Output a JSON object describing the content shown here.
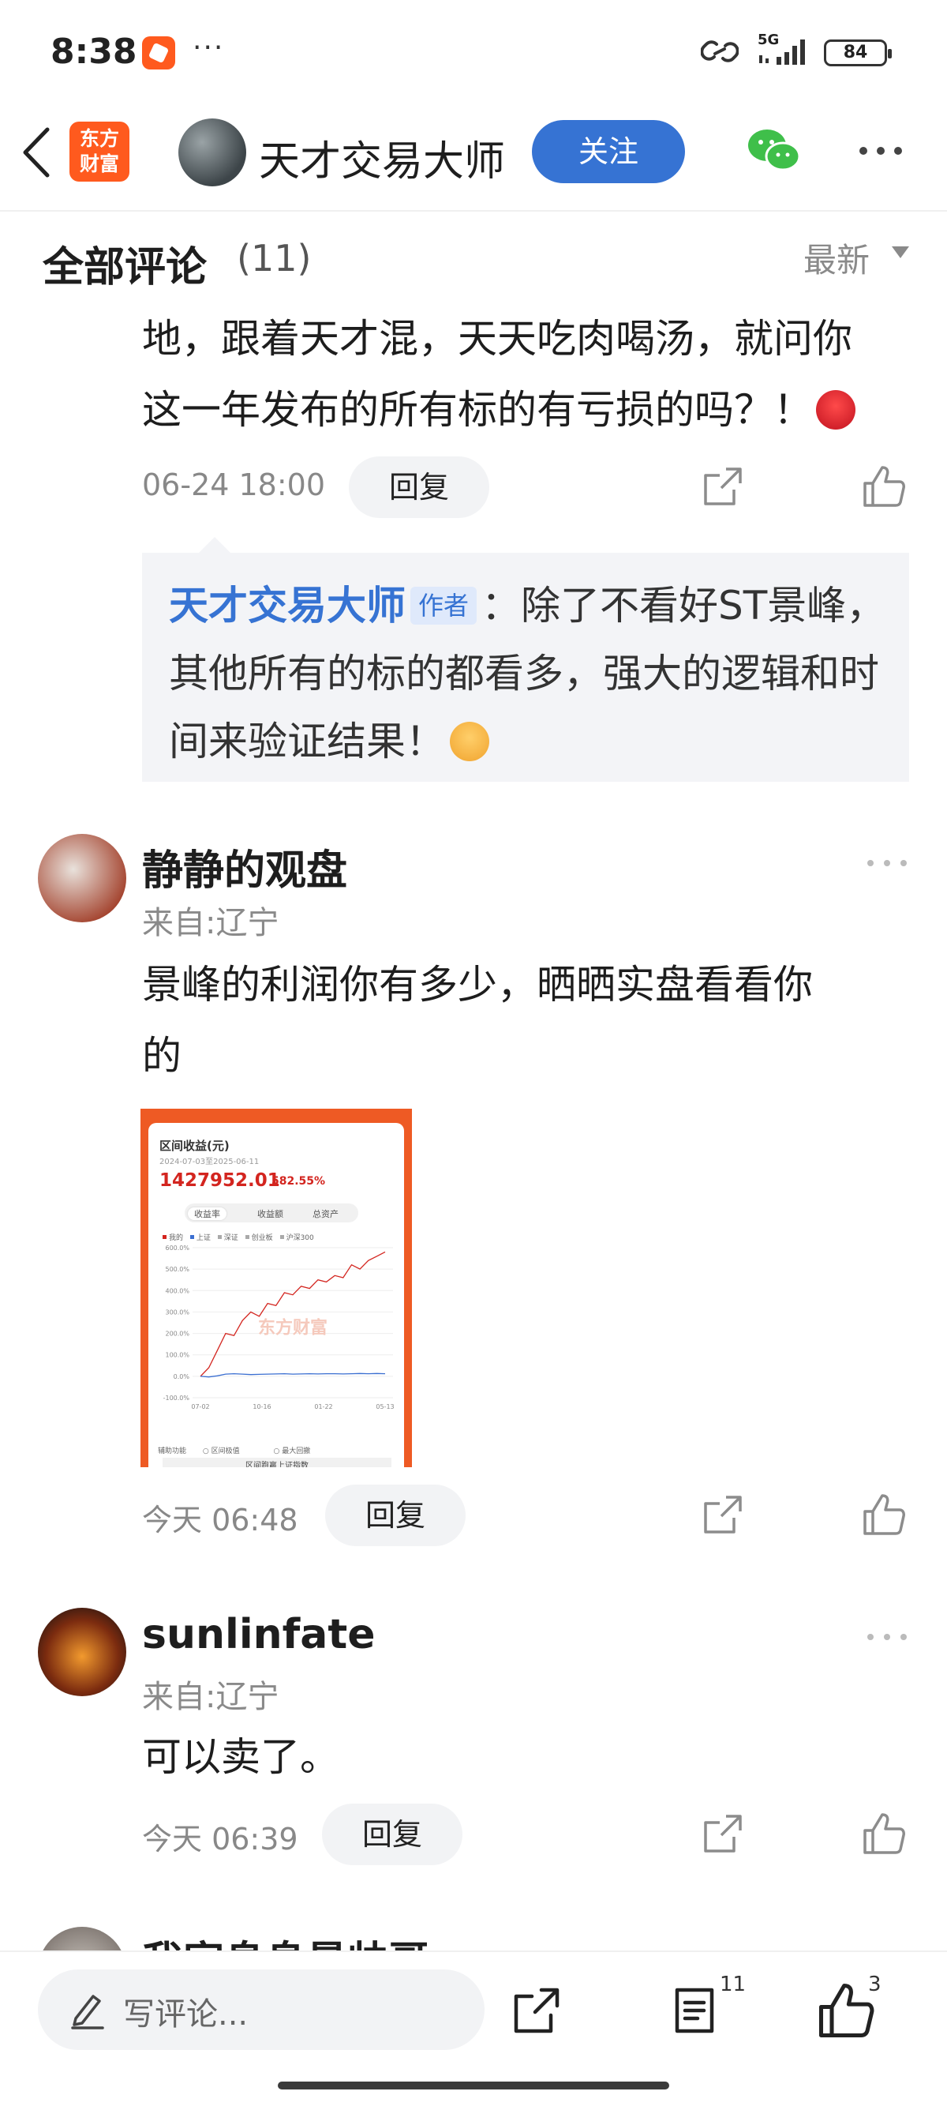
{
  "status_bar": {
    "time": "8:38",
    "dots": "···",
    "network": "5G",
    "battery": "84"
  },
  "header": {
    "brand_line1": "东方",
    "brand_line2": "财富",
    "author_name": "天才交易大师",
    "follow_label": "关注"
  },
  "comments_header": {
    "title": "全部评论",
    "count": "(11)",
    "sort_label": "最新"
  },
  "first_comment": {
    "line1": "地，跟着天才混，天天吃肉喝汤，就问你",
    "line2": "这一年发布的所有标的有亏损的吗？！",
    "time": "06-24 18:00",
    "reply_label": "回复",
    "author_reply": {
      "name": "天才交易大师",
      "tag": "作者",
      "text": "：除了不看好ST景峰，其他所有的标的都看多，强大的逻辑和时间来验证结果！"
    }
  },
  "comments": [
    {
      "username": "静静的观盘",
      "location": "来自:辽宁",
      "text_line1": "景峰的利润你有多少，晒晒实盘看看你",
      "text_line2": "的",
      "time": "今天 06:48",
      "reply_label": "回复"
    },
    {
      "username": "sunlinfate",
      "location": "来自:辽宁",
      "text_line1": "可以卖了。",
      "time": "今天 06:39",
      "reply_label": "回复"
    },
    {
      "username": "我家息息最帅哥"
    }
  ],
  "thumbnail": {
    "title": "区间收益(元)",
    "date_range": "2024-07-03至2025-06-11",
    "value": "1427952.01",
    "percent": "582.55%",
    "tabs": [
      "收益率",
      "收益额",
      "总资产"
    ],
    "legend": [
      "我的",
      "上证",
      "深证",
      "创业板",
      "沪深300"
    ],
    "watermark": "东方财富",
    "footer_assist": "辅助功能",
    "footer_opt1": "区间极值",
    "footer_opt2": "最大回撤",
    "footer_button": "区间跑赢上证指数",
    "chart_data": {
      "type": "line",
      "x_ticks": [
        "07-02",
        "10-16",
        "01-22",
        "05-13"
      ],
      "y_ticks": [
        "600.0%",
        "500.0%",
        "400.0%",
        "300.0%",
        "200.0%",
        "100.0%",
        "0.0%",
        "-100.0%"
      ],
      "ylim": [
        -100,
        600
      ],
      "series": [
        {
          "name": "我的",
          "color": "#d3251f",
          "values": [
            0,
            40,
            120,
            200,
            190,
            260,
            300,
            280,
            340,
            330,
            390,
            380,
            420,
            410,
            450,
            440,
            470,
            460,
            520,
            500,
            540,
            560,
            580
          ]
        },
        {
          "name": "上证",
          "color": "#3b6fd1",
          "values": [
            0,
            -3,
            2,
            10,
            12,
            10,
            8,
            9,
            10,
            11,
            12,
            10,
            11,
            12,
            11,
            12,
            12,
            11,
            12,
            13,
            12,
            13,
            12
          ]
        }
      ]
    }
  },
  "bottom_bar": {
    "placeholder": "写评论...",
    "comment_count": "11",
    "like_count": "3"
  }
}
